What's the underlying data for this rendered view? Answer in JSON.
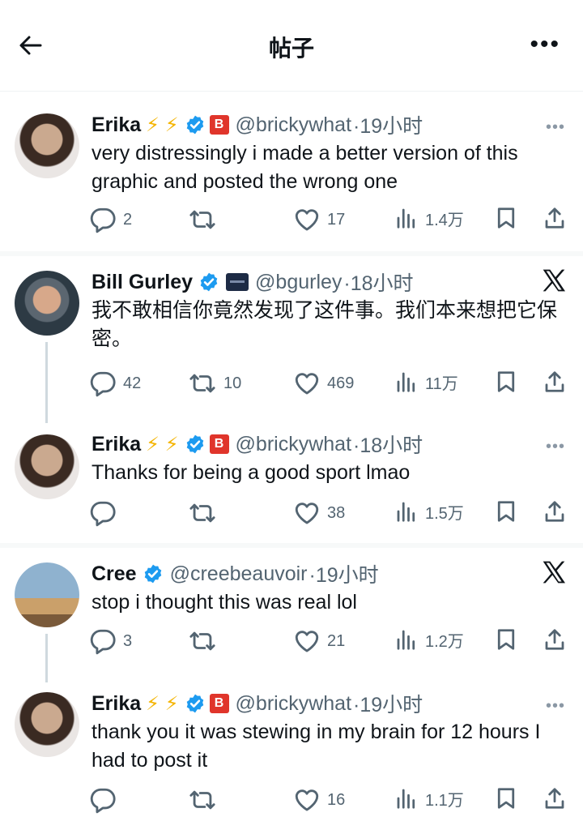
{
  "header": {
    "title": "帖子"
  },
  "tweets": [
    {
      "name": "Erika",
      "bolts": "⚡ ⚡",
      "badge": "B",
      "handle": "@brickywhat",
      "time": "·19小时",
      "text": "very distressingly i made a better version of this graphic and posted the wrong one",
      "replies": "2",
      "retweets": "",
      "likes": "17",
      "views": "1.4万"
    },
    {
      "name": "Bill Gurley",
      "handle": "@bgurley",
      "time": "·18小时",
      "text": "我不敢相信你竟然发现了这件事。我们本来想把它保密。",
      "replies": "42",
      "retweets": "10",
      "likes": "469",
      "views": "11万"
    },
    {
      "name": "Erika",
      "bolts": "⚡ ⚡",
      "badge": "B",
      "handle": "@brickywhat",
      "time": "·18小时",
      "text": "Thanks for being a good sport lmao",
      "replies": "",
      "retweets": "",
      "likes": "38",
      "views": "1.5万"
    },
    {
      "name": "Cree",
      "handle": "@creebeauvoir",
      "time": "·19小时",
      "text": "stop i thought this was real lol",
      "replies": "3",
      "retweets": "",
      "likes": "21",
      "views": "1.2万"
    },
    {
      "name": "Erika",
      "bolts": "⚡ ⚡",
      "badge": "B",
      "handle": "@brickywhat",
      "time": "·19小时",
      "text": "thank you it was stewing in my brain for 12 hours I had to post it",
      "replies": "",
      "retweets": "",
      "likes": "16",
      "views": "1.1万"
    }
  ],
  "colors": {
    "verified": "#1d9bf0",
    "secondary_text": "#536471",
    "divider": "#eff3f4",
    "bolt": "#f4b400",
    "badge_b": "#e0352b"
  },
  "icons": [
    "back-arrow-icon",
    "more-icon",
    "verified-icon",
    "x-logo-icon",
    "reply-icon",
    "retweet-icon",
    "like-icon",
    "views-icon",
    "bookmark-icon",
    "share-icon"
  ]
}
